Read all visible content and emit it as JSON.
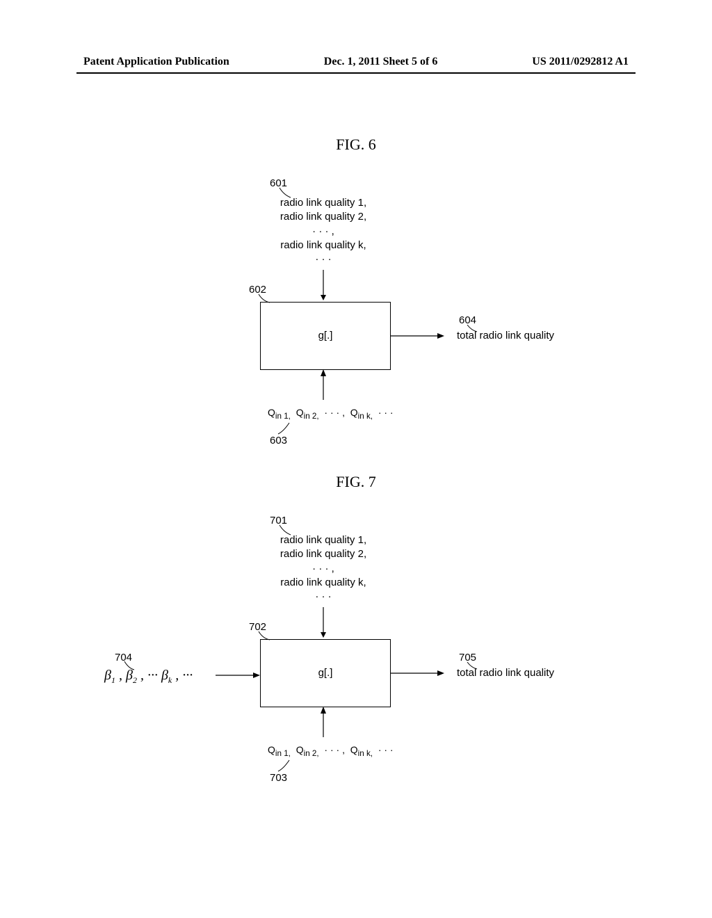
{
  "header": {
    "left": "Patent Application Publication",
    "center": "Dec. 1, 2011  Sheet 5 of 6",
    "right": "US 2011/0292812 A1"
  },
  "fig6": {
    "title": "FIG. 6",
    "num_601": "601",
    "rlq_1": "radio link quality 1,",
    "rlq_2": "radio link quality 2,",
    "rlq_ell1": "· · · ,",
    "rlq_k": "radio link quality k,",
    "rlq_ell2": "· · ·",
    "num_602": "602",
    "g_label": "g[.]",
    "num_604": "604",
    "out_label": "total radio link quality",
    "qin": "Q_in 1,   Q_in 2,   · · · ,   Q_in k,   · · ·",
    "num_603": "603"
  },
  "fig7": {
    "title": "FIG. 7",
    "num_701": "701",
    "rlq_1": "radio link quality 1,",
    "rlq_2": "radio link quality 2,",
    "rlq_ell1": "· · · ,",
    "rlq_k": "radio link quality k,",
    "rlq_ell2": "· · ·",
    "num_702": "702",
    "num_704": "704",
    "beta": "β₁ , β₂ , ··· βₖ , ···",
    "g_label": "g[.]",
    "num_705": "705",
    "out_label": "total radio link quality",
    "qin": "Q_in 1,   Q_in 2,   · · · ,   Q_in k,   · · ·",
    "num_703": "703"
  }
}
